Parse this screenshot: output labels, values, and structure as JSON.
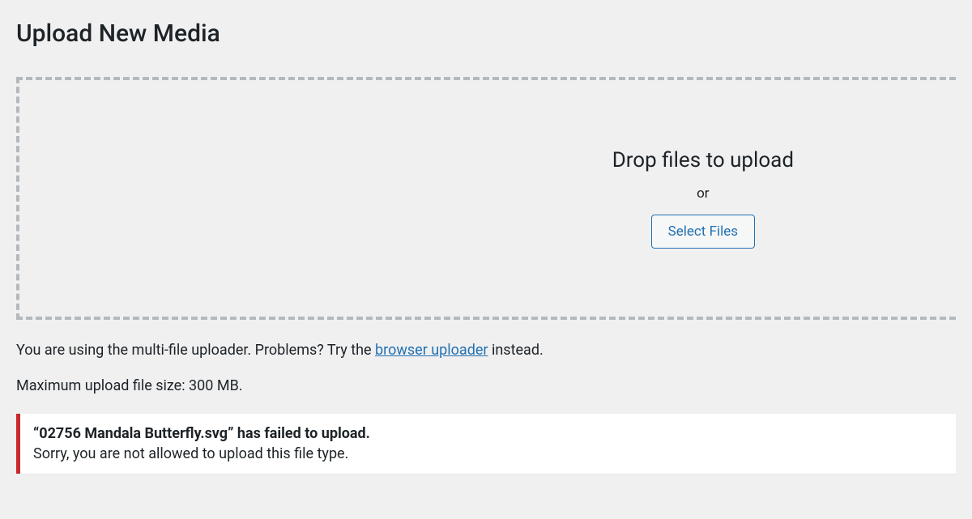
{
  "page": {
    "title": "Upload New Media"
  },
  "dropzone": {
    "instructions": "Drop files to upload",
    "or": "or",
    "button_label": "Select Files"
  },
  "notes": {
    "uploader_prefix": "You are using the multi-file uploader. Problems? Try the ",
    "uploader_link": "browser uploader",
    "uploader_suffix": " instead.",
    "max_size": "Maximum upload file size: 300 MB."
  },
  "errors": [
    {
      "title": "“02756 Mandala Butterfly.svg” has failed to upload.",
      "message": "Sorry, you are not allowed to upload this file type."
    }
  ]
}
